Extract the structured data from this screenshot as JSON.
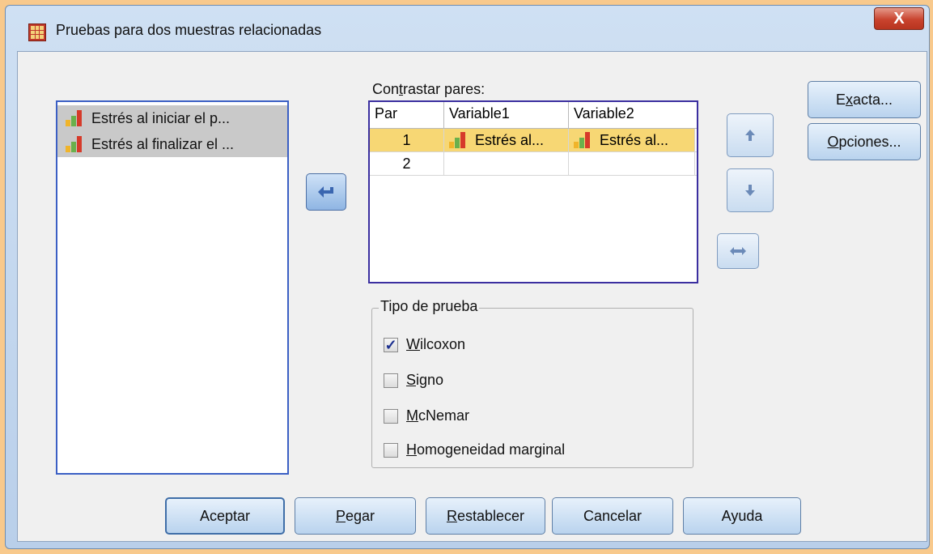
{
  "window": {
    "title": "Pruebas para dos muestras relacionadas",
    "close_glyph": "X"
  },
  "variables": [
    {
      "label": "Estrés al iniciar el p..."
    },
    {
      "label": "Estrés al finalizar el ..."
    }
  ],
  "pairs": {
    "label_pre": "Con",
    "label_mn": "t",
    "label_post": "rastar pares:",
    "headers": [
      "Par",
      "Variable1",
      "Variable2"
    ],
    "rows": [
      {
        "par": "1",
        "var1": "Estrés al...",
        "var2": "Estrés al...",
        "selected": true
      },
      {
        "par": "2",
        "var1": "",
        "var2": "",
        "selected": false
      }
    ]
  },
  "side_buttons": {
    "exacta": {
      "pre": "E",
      "mn": "x",
      "post": "acta..."
    },
    "opciones": {
      "pre": "",
      "mn": "O",
      "post": "pciones..."
    }
  },
  "test_type": {
    "label": "Tipo de prueba",
    "options": [
      {
        "mn": "W",
        "rest": "ilcoxon",
        "checked": true
      },
      {
        "mn": "S",
        "rest": "igno",
        "checked": false
      },
      {
        "mn": "M",
        "rest": "cNemar",
        "checked": false
      },
      {
        "mn": "H",
        "rest": "omogeneidad marginal",
        "checked": false
      }
    ]
  },
  "buttons": {
    "aceptar": "Aceptar",
    "pegar": {
      "mn": "P",
      "rest": "egar"
    },
    "restablecer": {
      "mn": "R",
      "rest": "establecer"
    },
    "cancelar": "Cancelar",
    "ayuda": "Ayuda"
  },
  "colors": {
    "selection": "#f7d774",
    "accent_border": "#3b5fc4",
    "titlebar_close": "#c9432e"
  },
  "icons": {
    "transfer": "transfer-left-arrow-icon",
    "move_up": "arrow-up-icon",
    "move_down": "arrow-down-icon",
    "swap": "swap-horizontal-icon",
    "scale_variable": "scale-variable-icon"
  }
}
